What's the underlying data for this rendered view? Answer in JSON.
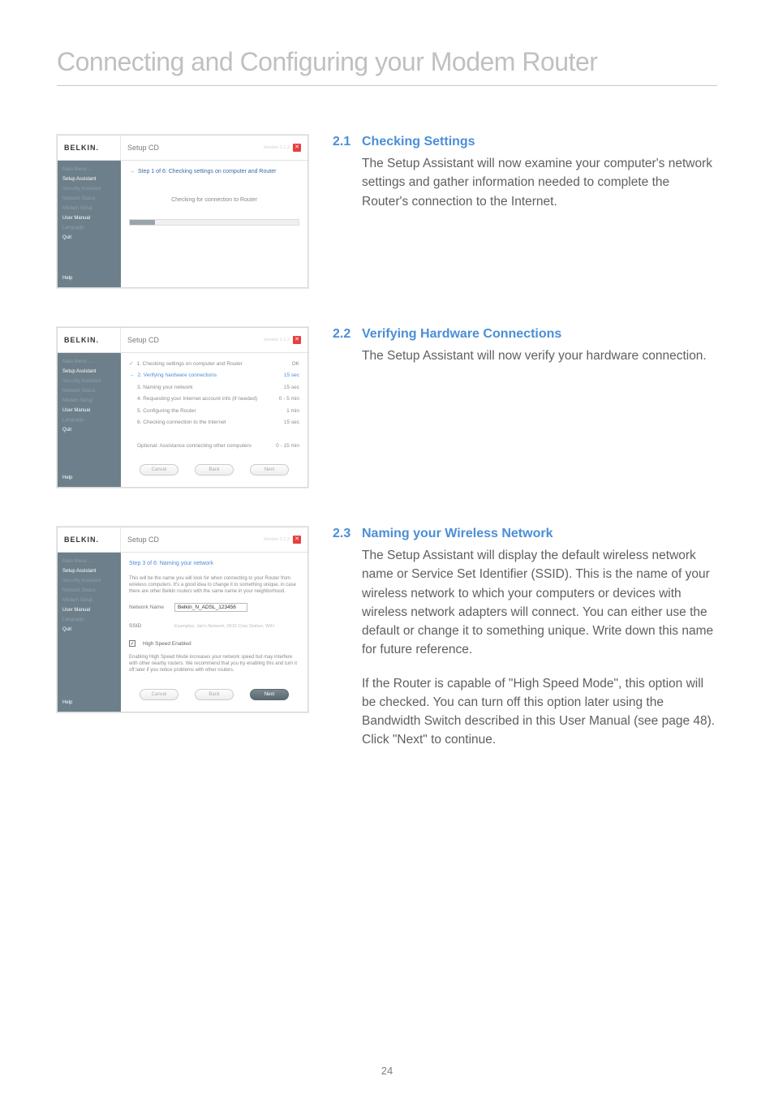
{
  "pageTitle": "Connecting and Configuring your Modem Router",
  "pageNumber": "24",
  "common": {
    "brand": "BELKIN.",
    "setupTitle": "Setup CD",
    "version": "Version 1.1.2",
    "closeGlyph": "✕",
    "sidebar": {
      "mainMenu": "Main Menu →",
      "setupAssistant": "Setup Assistant",
      "securityAssistant": "Security Assistant",
      "networkStatus": "Network Status",
      "modemSetup": "Modem Setup",
      "userManual": "User Manual",
      "language": "Language",
      "quit": "Quit",
      "help": "Help"
    },
    "buttons": {
      "cancel": "Cancel",
      "back": "Back",
      "next": "Next"
    }
  },
  "steps": [
    {
      "num": "2.1",
      "title": "Checking Settings",
      "paras": [
        "The Setup Assistant will now examine your computer's network settings and gather information needed to complete the Router's connection to the Internet."
      ],
      "shot": {
        "stepLabel": "Step 1 of 6: Checking settings on computer and Router",
        "checking": "Checking for connection to Router"
      }
    },
    {
      "num": "2.2",
      "title": "Verifying Hardware Connections",
      "paras": [
        "The Setup Assistant will now verify your hardware connection."
      ],
      "shot": {
        "rows": [
          {
            "label": "1. Checking settings on computer and Router",
            "val": "OK",
            "check": true
          },
          {
            "label": "2. Verifying hardware connections",
            "val": "15 sec",
            "hl": true
          },
          {
            "label": "3. Naming your network",
            "val": "15 sec"
          },
          {
            "label": "4. Requesting your Internet account info (if needed)",
            "val": "0 - 5 min"
          },
          {
            "label": "5. Configuring the Router",
            "val": "1 min"
          },
          {
            "label": "6. Checking connection to the Internet",
            "val": "15 sec"
          }
        ],
        "optional": {
          "label": "Optional: Assistance connecting other computers",
          "val": "0 - 15 min"
        }
      }
    },
    {
      "num": "2.3",
      "title": "Naming your Wireless Network",
      "paras": [
        "The Setup Assistant will display the default wireless network name or Service Set Identifier (SSID). This is the name of your wireless network to which your computers or devices with wireless network adapters will connect. You can either use the default or change it to something unique. Write down this name for future reference.",
        "If the Router is capable of \"High Speed Mode\", this option will be checked. You can turn off this option later using the Bandwidth Switch described in this User Manual (see page 48). Click \"Next\" to continue."
      ],
      "shot": {
        "subhead": "Step 3 of 6: Naming your network",
        "intro": "This will be the name you will look for when connecting to your Router from wireless computers. It's a good idea to change it to something unique, in case there are other Belkin routers with the same name in your neighborhood.",
        "netNameLabel": "Network Name",
        "netNameValue": "Belkin_N_ADSL_123456",
        "ssidLabel": "SSID",
        "ssidHint": "Examples: Jan's Network, 0915 Corp Station, WiFi",
        "hseLabel": "High Speed Enabled",
        "hseNote": "Enabling High Speed Mode increases your network speed but may interfere with other nearby routers. We recommend that you try enabling this and turn it off later if you notice problems with other routers."
      }
    }
  ]
}
